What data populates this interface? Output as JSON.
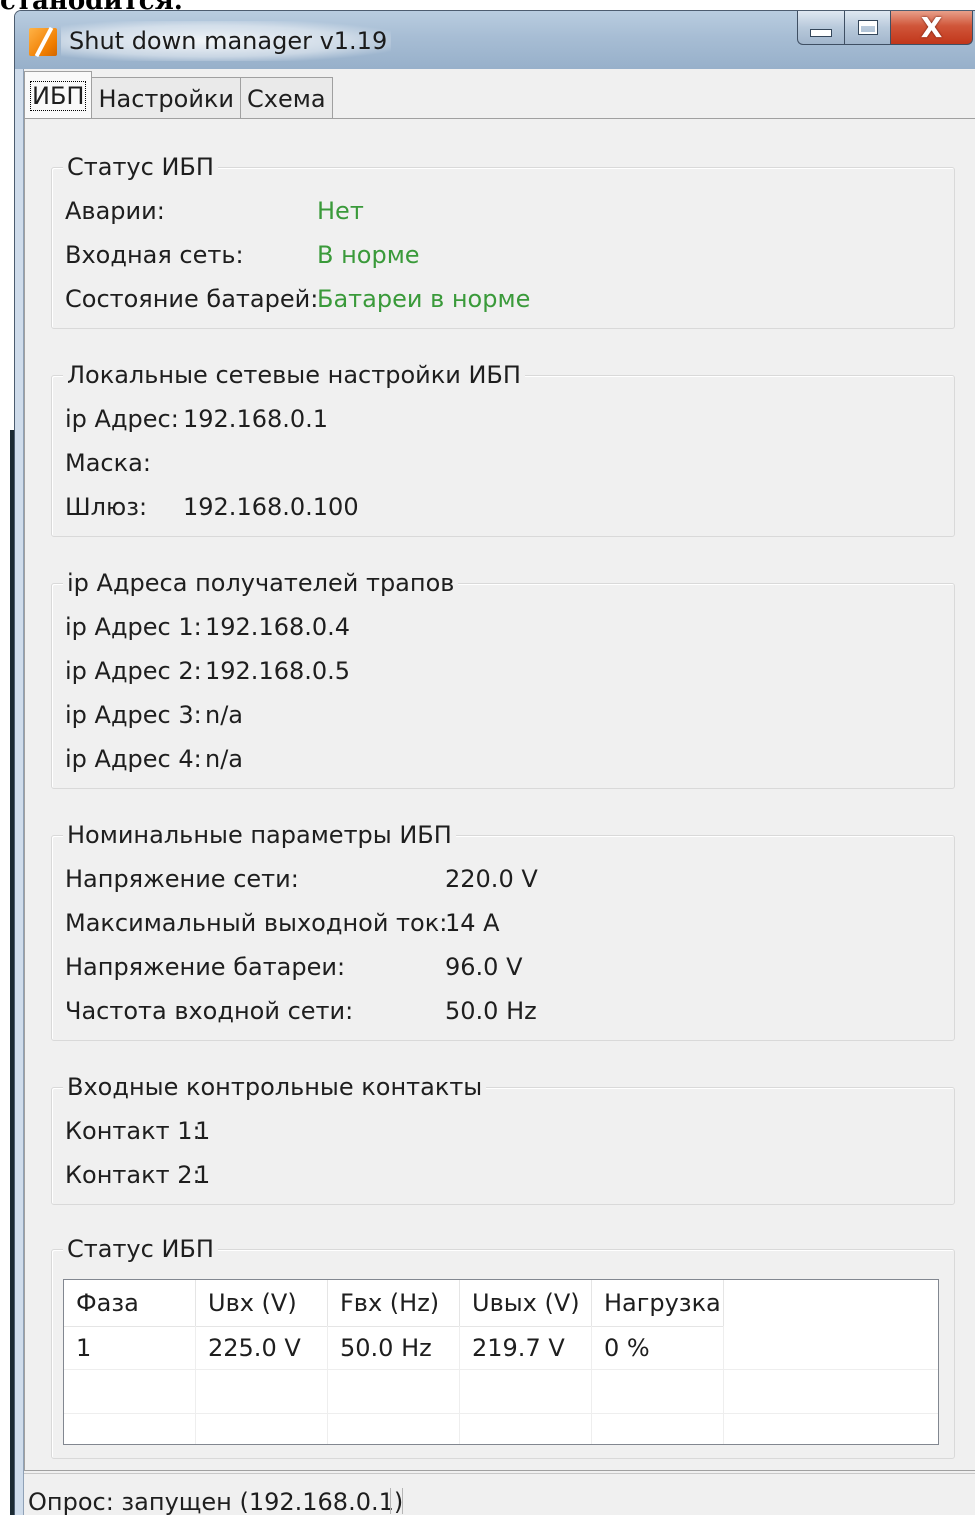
{
  "page_fragment": "станоdится.",
  "window": {
    "title": "Shut down manager  v1.19",
    "close_symbol": "X"
  },
  "tabs": [
    "ИБП",
    "Настройки",
    "Схема"
  ],
  "groups": {
    "ups_status": {
      "title": "Статус ИБП",
      "rows": [
        {
          "label": "Аварии:",
          "value": "Нет"
        },
        {
          "label": "Входная сеть:",
          "value": "В норме"
        },
        {
          "label": "Состояние батарей:",
          "value": "Батареи в норме"
        }
      ],
      "value_color": "#3a9a3a"
    },
    "network": {
      "title": "Локальные сетевые настройки ИБП",
      "rows": [
        {
          "label": "ip Адрес:",
          "value": "192.168.0.1"
        },
        {
          "label": "Маска:",
          "value": ""
        },
        {
          "label": "Шлюз:",
          "value": "192.168.0.100"
        }
      ]
    },
    "trap_receivers": {
      "title": "ip Адреса получателей трапов",
      "rows": [
        {
          "label": "ip Адрес 1:",
          "value": "192.168.0.4"
        },
        {
          "label": "ip Адрес 2:",
          "value": "192.168.0.5"
        },
        {
          "label": "ip Адрес 3:",
          "value": "n/a"
        },
        {
          "label": "ip Адрес 4:",
          "value": "n/a"
        }
      ]
    },
    "nominal": {
      "title": "Номинальные параметры ИБП",
      "rows": [
        {
          "label": "Напряжение сети:",
          "value": "220.0 V"
        },
        {
          "label": "Максимальный выходной ток:",
          "value": "14 A"
        },
        {
          "label": "Напряжение батареи:",
          "value": "96.0 V"
        },
        {
          "label": "Частота входной сети:",
          "value": "50.0 Hz"
        }
      ]
    },
    "contacts": {
      "title": "Входные контрольные контакты",
      "rows": [
        {
          "label": "Контакт 1:",
          "value": "1"
        },
        {
          "label": "Контакт 2:",
          "value": "1"
        }
      ]
    },
    "phase_status": {
      "title": "Статус ИБП",
      "columns": [
        "Фаза",
        "Uвх (V)",
        "Fвх (Hz)",
        "Uвых (V)",
        "Нагрузка"
      ],
      "rows": [
        [
          "1",
          "225.0 V",
          "50.0 Hz",
          "219.7 V",
          "0 %"
        ]
      ]
    }
  },
  "statusbar": {
    "text": "Опрос: запущен (192.168.0.1)"
  }
}
